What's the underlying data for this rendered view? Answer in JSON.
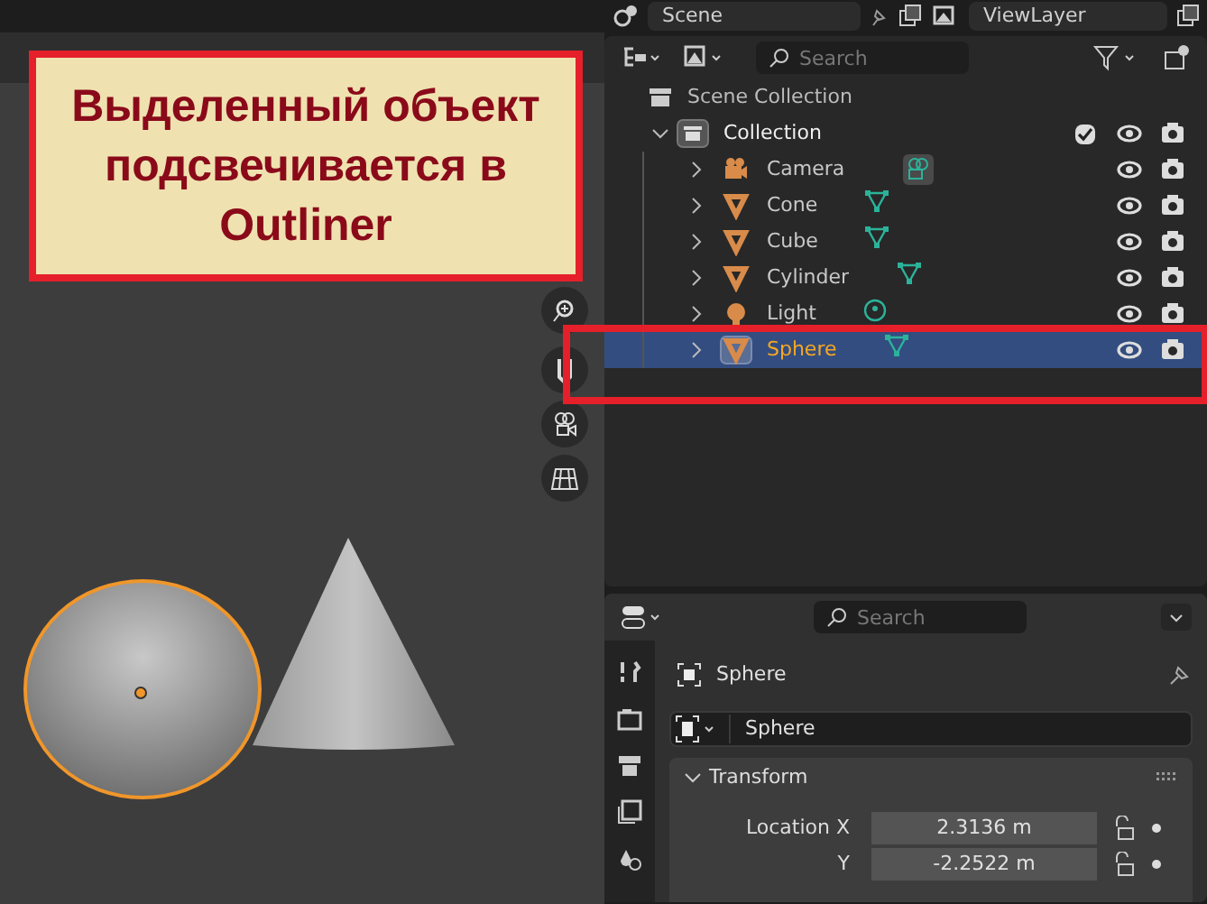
{
  "header": {
    "scene": "Scene",
    "view_layer": "ViewLayer"
  },
  "callout": {
    "text": "Выделенный объект подсвечивается в Outliner"
  },
  "outliner": {
    "search": {
      "placeholder": "Search"
    },
    "scene_collection": "Scene Collection",
    "collection": {
      "label": "Collection",
      "expanded": true,
      "checked": true
    },
    "items": [
      {
        "label": "Camera",
        "kind": "camera",
        "selected": false
      },
      {
        "label": "Cone",
        "kind": "mesh",
        "selected": false
      },
      {
        "label": "Cube",
        "kind": "mesh",
        "selected": false
      },
      {
        "label": "Cylinder",
        "kind": "mesh",
        "selected": false
      },
      {
        "label": "Light",
        "kind": "light",
        "selected": false
      },
      {
        "label": "Sphere",
        "kind": "mesh",
        "selected": true
      }
    ]
  },
  "properties": {
    "search": {
      "placeholder": "Search"
    },
    "object_name": "Sphere",
    "name_field": "Sphere",
    "panel": {
      "title": "Transform",
      "expanded": true
    },
    "fields": [
      {
        "label": "Location X",
        "value": "2.3136 m"
      },
      {
        "label": "Y",
        "value": "-2.2522 m"
      }
    ]
  }
}
